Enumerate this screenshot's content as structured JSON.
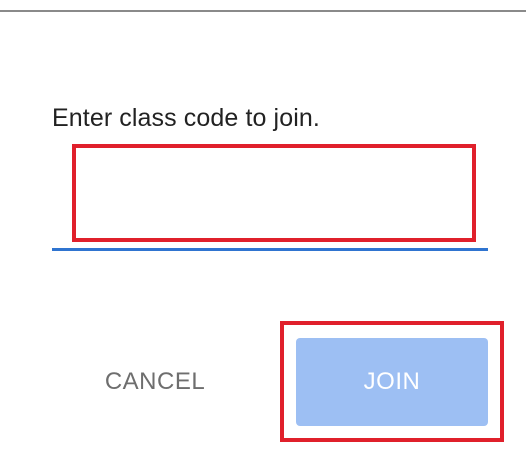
{
  "dialog": {
    "prompt": "Enter class code to join.",
    "input": {
      "value": "",
      "placeholder": ""
    },
    "buttons": {
      "cancel_label": "CANCEL",
      "join_label": "JOIN"
    }
  },
  "colors": {
    "accent_underline": "#2f74d0",
    "join_button_bg": "#9dbff3",
    "highlight_box": "#e0202b"
  }
}
